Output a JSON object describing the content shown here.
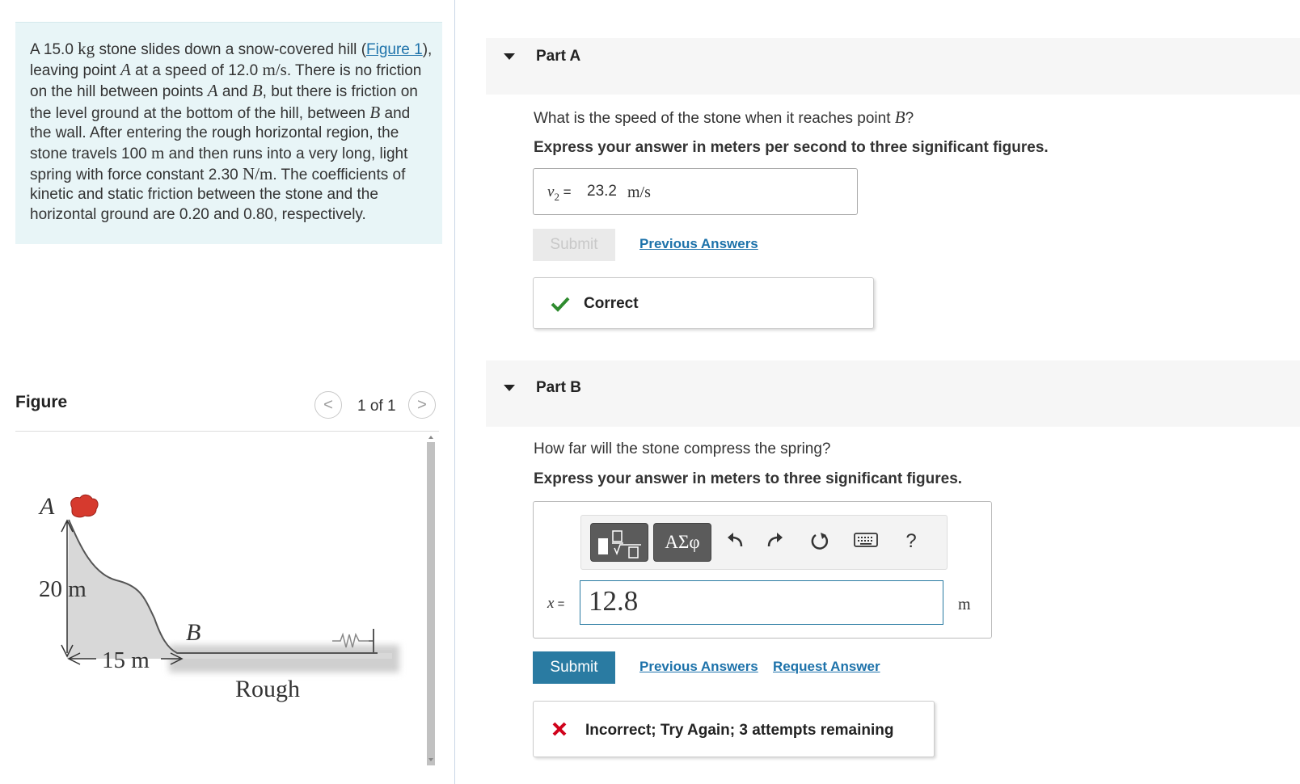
{
  "problem": {
    "p1": "A 15.0 ",
    "kg": "kg",
    "p2": " stone slides down a snow-covered hill",
    "figure_link": "Figure 1",
    "p3": "(",
    "p4": "), leaving point ",
    "A": "A",
    "p5": " at a speed of 12.0 ",
    "ms": "m/s",
    "p6": ". There is no friction on the hill between points ",
    "p7": " and ",
    "B": "B",
    "p8": ", but there is friction on the level ground at the bottom of the hill, between ",
    "p9": " and the wall. After entering the rough horizontal region, the stone travels 100 ",
    "m": "m",
    "p10": " and then runs into a very long, light spring with force constant 2.30 ",
    "Nm": "N/m",
    "p11": ". The coefficients of kinetic and static friction between the stone and the horizontal ground are 0.20 and 0.80, respectively."
  },
  "figure": {
    "title": "Figure",
    "pager": "1 of 1",
    "prev": "<",
    "next": ">",
    "label_A": "A",
    "label_B": "B",
    "label_height": "20 m",
    "label_width": "15 m",
    "label_rough": "Rough"
  },
  "partA": {
    "title": "Part A",
    "question_pre": "What is the speed of the stone when it reaches point ",
    "question_var": "B",
    "question_post": "?",
    "instruction": "Express your answer in meters per second to three significant figures.",
    "answer_var": "v",
    "answer_sub": "2",
    "answer_eq": " = ",
    "answer_value": "23.2",
    "answer_unit": "m/s",
    "submit": "Submit",
    "previous_answers": "Previous Answers",
    "feedback": "Correct"
  },
  "partB": {
    "title": "Part B",
    "question": "How far will the stone compress the spring?",
    "instruction": "Express your answer in meters to three significant figures.",
    "answer_var": "x",
    "answer_eq": " =",
    "answer_value": "12.8",
    "answer_unit": "m",
    "toolbar": {
      "greek": "ΑΣφ",
      "help": "?"
    },
    "submit": "Submit",
    "previous_answers": "Previous Answers",
    "request_answer": "Request Answer",
    "feedback": "Incorrect; Try Again; 3 attempts remaining"
  },
  "colors": {
    "accent": "#2a7ba2",
    "link": "#1d72aa",
    "correct": "#2e8b2e",
    "incorrect": "#d0021b",
    "problem_bg": "#e8f5f7"
  }
}
